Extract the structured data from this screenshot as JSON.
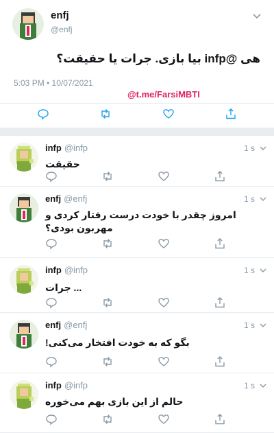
{
  "main_tweet": {
    "name": "enfj",
    "handle": "@enfj",
    "text": "هی @infp بیا بازی. جرات یا حقیقت؟",
    "timestamp": "5:03 PM • 10/07/2021"
  },
  "watermark": "@t.me/FarsiMBTI",
  "replies": [
    {
      "name": "infp",
      "handle": "@infp",
      "time": "1 s",
      "text": "حقیقت"
    },
    {
      "name": "enfj",
      "handle": "@enfj",
      "time": "1 s",
      "text": "امروز چقدر با خودت درست رفتار کردی و مهربون بودی؟"
    },
    {
      "name": "infp",
      "handle": "@infp",
      "time": "1 s",
      "text": "... جرات"
    },
    {
      "name": "enfj",
      "handle": "@enfj",
      "time": "1 s",
      "text": "بگو که به خودت افتخار می‌کنی!"
    },
    {
      "name": "infp",
      "handle": "@infp",
      "time": "1 s",
      "text": "حالم از این بازی بهم می‌خوره"
    }
  ],
  "icons": {
    "reply": "comment-icon",
    "retweet": "retweet-icon",
    "like": "heart-icon",
    "share": "share-icon",
    "more": "chevron-down-icon"
  },
  "colors": {
    "accent": "#1da1f2",
    "watermark": "#e0245e",
    "muted": "#8899a6",
    "divider": "#e9edf0"
  }
}
